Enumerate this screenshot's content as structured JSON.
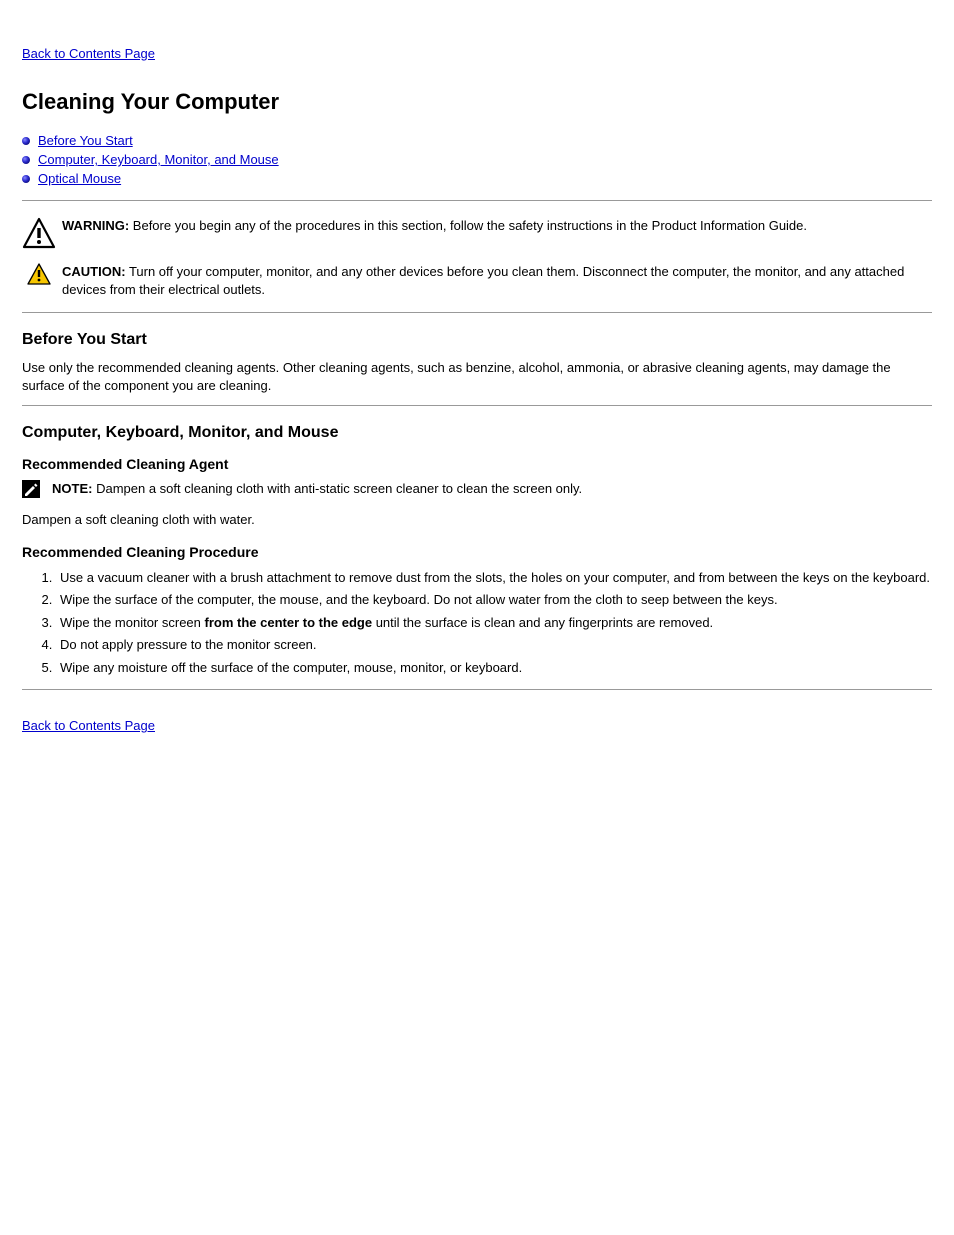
{
  "top_link": "Back to Contents Page",
  "page_title": "Cleaning Your Computer",
  "nav": {
    "items": [
      {
        "label": "Before You Start"
      },
      {
        "label": "Computer, Keyboard, Monitor, and Mouse"
      },
      {
        "label": "Optical Mouse"
      }
    ]
  },
  "warning": {
    "lead": "WARNING:",
    "text": "Before you begin any of the procedures in this section, follow the safety instructions in the Product Information Guide."
  },
  "caution": {
    "lead": "CAUTION:",
    "text": "Turn off your computer, monitor, and any other devices before you clean them. Disconnect the computer, the monitor, and any attached devices from their electrical outlets."
  },
  "s1": {
    "heading": "Before You Start",
    "body": "Use only the recommended cleaning agents. Other cleaning agents, such as benzine, alcohol, ammonia, or abrasive cleaning agents, may damage the surface of the component you are cleaning."
  },
  "s2": {
    "heading": "Computer, Keyboard, Monitor, and Mouse",
    "sub": "Recommended Cleaning Agent",
    "note": {
      "lead": "NOTE:",
      "text": "Dampen a soft cleaning cloth with anti-static screen cleaner to clean the screen only."
    },
    "body": "Dampen a soft cleaning cloth with water.",
    "sub2": "Recommended Cleaning Procedure",
    "steps": [
      {
        "pre": "Use a vacuum cleaner with a brush attachment to remove dust from the slots, the holes on your computer, and from between the keys on the keyboard.",
        "bold": "",
        "post": ""
      },
      {
        "pre": "Wipe the surface of the computer, the mouse, and the keyboard. Do not allow water from the cloth to seep between the keys.",
        "bold": "",
        "post": ""
      },
      {
        "pre": "Wipe the monitor screen ",
        "bold": "from the center to the edge",
        "post": " until the surface is clean and any fingerprints are removed."
      },
      {
        "pre": "Do not apply pressure to the monitor screen.",
        "bold": "",
        "post": ""
      },
      {
        "pre": "Wipe any moisture off the surface of the computer, mouse, monitor, or keyboard.",
        "bold": "",
        "post": ""
      }
    ]
  },
  "bottom_link": "Back to Contents Page"
}
